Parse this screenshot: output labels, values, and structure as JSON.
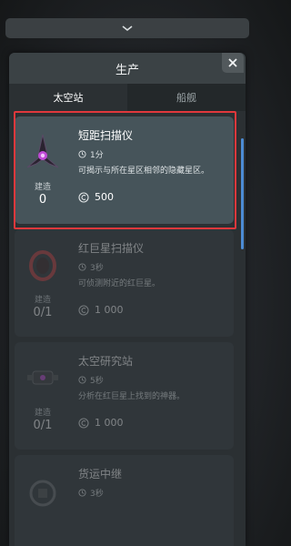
{
  "panel": {
    "title": "生产"
  },
  "tabs": [
    {
      "label": "太空站",
      "active": true
    },
    {
      "label": "船舰",
      "active": false
    }
  ],
  "items": [
    {
      "name": "短距扫描仪",
      "time": "1分",
      "desc": "可揭示与所在星区相邻的隐藏星区。",
      "cost": "500",
      "build_label": "建造",
      "build_count": "0",
      "icon": "short-range-scanner-icon",
      "state": "selected"
    },
    {
      "name": "红巨星扫描仪",
      "time": "3秒",
      "desc": "可侦测附近的红巨星。",
      "cost": "1 000",
      "build_label": "建造",
      "build_count": "0/1",
      "icon": "red-giant-scanner-icon",
      "state": "disabled"
    },
    {
      "name": "太空研究站",
      "time": "5秒",
      "desc": "分析在红巨星上找到的神器。",
      "cost": "1 000",
      "build_label": "建造",
      "build_count": "0/1",
      "icon": "space-research-station-icon",
      "state": "disabled"
    },
    {
      "name": "货运中继",
      "time": "3秒",
      "desc": "",
      "cost": "",
      "build_label": "",
      "build_count": "",
      "icon": "cargo-relay-icon",
      "state": "disabled"
    }
  ],
  "colors": {
    "highlight_border": "#e0383c",
    "scrollbar": "#4c8bd4",
    "accent_purple": "#c04ad6"
  }
}
